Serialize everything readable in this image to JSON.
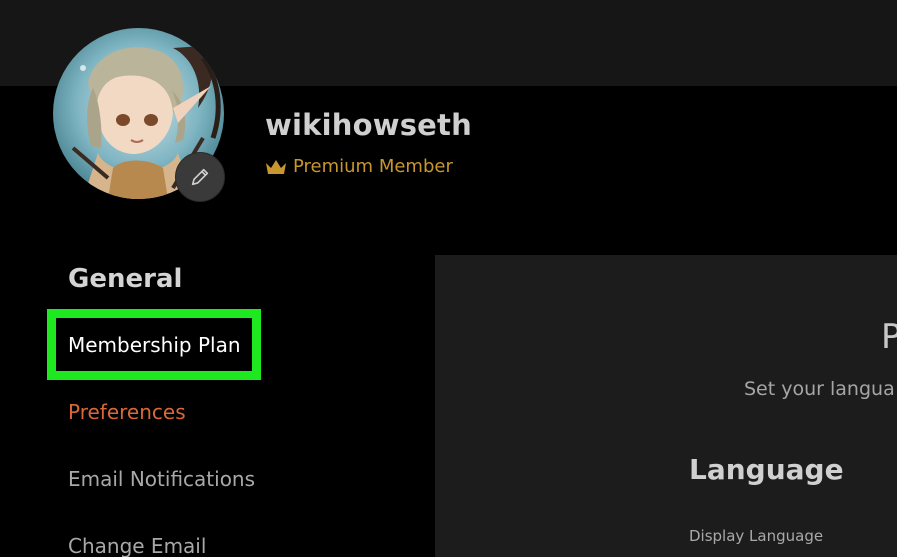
{
  "profile": {
    "username": "wikihowseth",
    "membership_badge": "Premium Member",
    "membership_icon": "crown-icon",
    "edit_icon": "pencil-icon"
  },
  "sidebar": {
    "heading": "General",
    "items": [
      {
        "label": "Membership Plan",
        "state": "highlighted"
      },
      {
        "label": "Preferences",
        "state": "active"
      },
      {
        "label": "Email Notifications",
        "state": "default"
      },
      {
        "label": "Change Email",
        "state": "default"
      }
    ]
  },
  "panel": {
    "title": "P",
    "subtitle": "Set your langua",
    "section_heading": "Language",
    "field_label": "Display Language"
  },
  "colors": {
    "background": "#000000",
    "top_bar": "#161616",
    "panel": "#1c1c1c",
    "premium_gold": "#c8962e",
    "active_orange": "#d8683a",
    "highlight_green": "#1ee820"
  }
}
